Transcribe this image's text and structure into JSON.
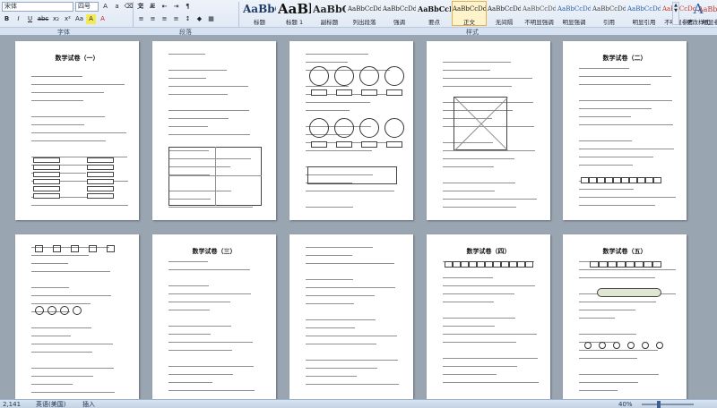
{
  "ribbon": {
    "font_name": "宋体",
    "font_size": "四号",
    "group_labels": {
      "font": "字体",
      "paragraph": "段落",
      "styles": "样式"
    },
    "styles": [
      {
        "sample": "AaBbC",
        "name": "标题",
        "size": "12px",
        "color": "#1f3a66",
        "bold": true
      },
      {
        "sample": "AaBl",
        "name": "标题 1",
        "size": "15px",
        "color": "#111111",
        "bold": true
      },
      {
        "sample": "AaBbC",
        "name": "副标题",
        "size": "11px",
        "color": "#222222",
        "bold": true
      },
      {
        "sample": "AaBbCcDd",
        "name": "列出段落",
        "size": "7px",
        "color": "#222222",
        "bold": false
      },
      {
        "sample": "AaBbCcDd",
        "name": "强调",
        "size": "7px",
        "color": "#222222",
        "bold": false
      },
      {
        "sample": "AaBbCcD",
        "name": "要点",
        "size": "8px",
        "color": "#111111",
        "bold": true
      },
      {
        "sample": "AaBbCcDd",
        "name": "正文",
        "size": "7px",
        "color": "#222222",
        "bold": false,
        "selected": true
      },
      {
        "sample": "AaBbCcDd",
        "name": "无间隔",
        "size": "7px",
        "color": "#222222",
        "bold": false
      },
      {
        "sample": "AaBbCcDd",
        "name": "不明显强调",
        "size": "7px",
        "color": "#555555",
        "bold": false
      },
      {
        "sample": "AaBbCcDd",
        "name": "明显强调",
        "size": "7px",
        "color": "#2f5fa8",
        "bold": false
      },
      {
        "sample": "AaBbCcDd",
        "name": "引用",
        "size": "7px",
        "color": "#444444",
        "bold": false
      },
      {
        "sample": "AaBbCcDd",
        "name": "明显引用",
        "size": "7px",
        "color": "#2f5fa8",
        "bold": false
      },
      {
        "sample": "AaBbCcDd",
        "name": "不明显参考",
        "size": "7px",
        "color": "#c0392b",
        "bold": false
      },
      {
        "sample": "AaBbCcI",
        "name": "明显参考",
        "size": "8px",
        "color": "#c0392b",
        "bold": false
      }
    ],
    "change_styles": {
      "glyph": "A",
      "label": "更改样式"
    },
    "font_tools": [
      "B",
      "I",
      "U",
      "abc",
      "x₂",
      "x²",
      "Aa",
      "A",
      "A"
    ],
    "para_tools": [
      "≡",
      "≡",
      "≡",
      "≡",
      "↕",
      "◆",
      "▦"
    ],
    "para_tools_top": [
      "☰",
      "☰",
      "⇤",
      "⇥",
      "¶"
    ]
  },
  "pages": [
    {
      "title": "数学试卷（一）"
    },
    {
      "title": ""
    },
    {
      "title": ""
    },
    {
      "title": ""
    },
    {
      "title": "数学试卷（二）"
    },
    {
      "title": ""
    },
    {
      "title": "数学试卷（三）"
    },
    {
      "title": ""
    },
    {
      "title": "数学试卷（四）"
    },
    {
      "title": "数学试卷（五）"
    }
  ],
  "status": {
    "page": "2,141",
    "language": "英语(美国)",
    "mode": "插入",
    "zoom": "40%"
  }
}
